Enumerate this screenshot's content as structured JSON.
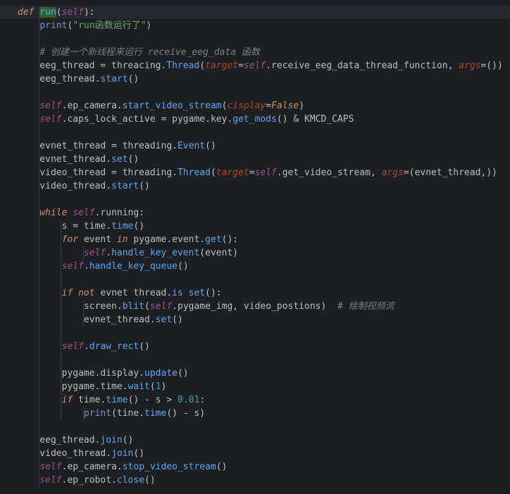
{
  "editor": {
    "language": "python",
    "theme_colors": {
      "background": "#1e1f22",
      "keyword": "#cf8e6d",
      "self": "#94558d",
      "function": "#56a8f5",
      "string": "#6aab73",
      "number": "#2aacb8",
      "comment": "#7a7e85",
      "text": "#bcbec4"
    },
    "lines": [
      [
        {
          "t": "def ",
          "c": "kw"
        },
        {
          "t": "run",
          "c": "fn hl"
        },
        {
          "t": "(",
          "c": "txt"
        },
        {
          "t": "self",
          "c": "self"
        },
        {
          "t": "):",
          "c": "txt"
        }
      ],
      [
        {
          "t": "    ",
          "c": "txt"
        },
        {
          "t": "print",
          "c": "builtin"
        },
        {
          "t": "(",
          "c": "txt"
        },
        {
          "t": "\"run函数运行了\"",
          "c": "str"
        },
        {
          "t": ")",
          "c": "txt"
        }
      ],
      [],
      [
        {
          "t": "    ",
          "c": "txt"
        },
        {
          "t": "# 创建一个新线程来运行 receive_eeg_data 函数",
          "c": "com"
        }
      ],
      [
        {
          "t": "    eeg_thread = threacing.",
          "c": "txt"
        },
        {
          "t": "Thread",
          "c": "fn"
        },
        {
          "t": "(",
          "c": "txt"
        },
        {
          "t": "target",
          "c": "param"
        },
        {
          "t": "=",
          "c": "txt"
        },
        {
          "t": "self",
          "c": "self"
        },
        {
          "t": ".receive_eeg_data_thread_function, ",
          "c": "txt"
        },
        {
          "t": "args",
          "c": "param"
        },
        {
          "t": "=())",
          "c": "txt"
        }
      ],
      [
        {
          "t": "    eeg_thread.",
          "c": "txt"
        },
        {
          "t": "start",
          "c": "fn"
        },
        {
          "t": "()",
          "c": "txt"
        }
      ],
      [],
      [
        {
          "t": "    ",
          "c": "txt"
        },
        {
          "t": "self",
          "c": "self"
        },
        {
          "t": ".ep_camera.",
          "c": "txt"
        },
        {
          "t": "start_video_stream",
          "c": "fn"
        },
        {
          "t": "(",
          "c": "txt"
        },
        {
          "t": "cisplay",
          "c": "param"
        },
        {
          "t": "=",
          "c": "txt"
        },
        {
          "t": "False",
          "c": "kw"
        },
        {
          "t": ")",
          "c": "txt"
        }
      ],
      [
        {
          "t": "    ",
          "c": "txt"
        },
        {
          "t": "self",
          "c": "self"
        },
        {
          "t": ".caps_lock_active = pygame.key.",
          "c": "txt"
        },
        {
          "t": "get_mods",
          "c": "fn"
        },
        {
          "t": "() & KMCD_CAPS",
          "c": "txt"
        }
      ],
      [],
      [
        {
          "t": "    evnet_thread = threading.",
          "c": "txt"
        },
        {
          "t": "Event",
          "c": "fn"
        },
        {
          "t": "()",
          "c": "txt"
        }
      ],
      [
        {
          "t": "    evnet_thread.",
          "c": "txt"
        },
        {
          "t": "set",
          "c": "fn"
        },
        {
          "t": "()",
          "c": "txt"
        }
      ],
      [
        {
          "t": "    video_thread = threading.",
          "c": "txt"
        },
        {
          "t": "Thread",
          "c": "fn"
        },
        {
          "t": "(",
          "c": "txt"
        },
        {
          "t": "target",
          "c": "param"
        },
        {
          "t": "=",
          "c": "txt"
        },
        {
          "t": "self",
          "c": "self"
        },
        {
          "t": ".get_video_stream, ",
          "c": "txt"
        },
        {
          "t": "args",
          "c": "param"
        },
        {
          "t": "=(evnet_thread,))",
          "c": "txt"
        }
      ],
      [
        {
          "t": "    video_thread.",
          "c": "txt"
        },
        {
          "t": "start",
          "c": "fn"
        },
        {
          "t": "()",
          "c": "txt"
        }
      ],
      [],
      [
        {
          "t": "    ",
          "c": "txt"
        },
        {
          "t": "while ",
          "c": "kw"
        },
        {
          "t": "self",
          "c": "self"
        },
        {
          "t": ".running:",
          "c": "txt"
        }
      ],
      [
        {
          "t": "        s = time.",
          "c": "txt"
        },
        {
          "t": "time",
          "c": "fn"
        },
        {
          "t": "()",
          "c": "txt"
        }
      ],
      [
        {
          "t": "        ",
          "c": "txt"
        },
        {
          "t": "for ",
          "c": "kw"
        },
        {
          "t": "event ",
          "c": "txt"
        },
        {
          "t": "in ",
          "c": "kw"
        },
        {
          "t": "pygame.event.",
          "c": "txt"
        },
        {
          "t": "get",
          "c": "fn"
        },
        {
          "t": "():",
          "c": "txt"
        }
      ],
      [
        {
          "t": "            ",
          "c": "txt"
        },
        {
          "t": "self",
          "c": "self"
        },
        {
          "t": ".",
          "c": "txt"
        },
        {
          "t": "handle_key_event",
          "c": "fn"
        },
        {
          "t": "(event)",
          "c": "txt"
        }
      ],
      [
        {
          "t": "        ",
          "c": "txt"
        },
        {
          "t": "self",
          "c": "self"
        },
        {
          "t": ".",
          "c": "txt"
        },
        {
          "t": "handle_key_queue",
          "c": "fn"
        },
        {
          "t": "()",
          "c": "txt"
        }
      ],
      [],
      [
        {
          "t": "        ",
          "c": "txt"
        },
        {
          "t": "if not ",
          "c": "kw"
        },
        {
          "t": "evnet thread.",
          "c": "txt"
        },
        {
          "t": "is set",
          "c": "fn"
        },
        {
          "t": "():",
          "c": "txt"
        }
      ],
      [
        {
          "t": "            screen.",
          "c": "txt"
        },
        {
          "t": "blit",
          "c": "fn"
        },
        {
          "t": "(",
          "c": "txt"
        },
        {
          "t": "self",
          "c": "self"
        },
        {
          "t": ".pygame_img, video_postions)  ",
          "c": "txt"
        },
        {
          "t": "# 绘制视频流",
          "c": "com"
        }
      ],
      [
        {
          "t": "            evnet_thread.",
          "c": "txt"
        },
        {
          "t": "set",
          "c": "fn"
        },
        {
          "t": "()",
          "c": "txt"
        }
      ],
      [],
      [
        {
          "t": "        ",
          "c": "txt"
        },
        {
          "t": "self",
          "c": "self"
        },
        {
          "t": ".",
          "c": "txt"
        },
        {
          "t": "draw_rect",
          "c": "fn"
        },
        {
          "t": "()",
          "c": "txt"
        }
      ],
      [],
      [
        {
          "t": "        pygame.display.",
          "c": "txt"
        },
        {
          "t": "update",
          "c": "fn"
        },
        {
          "t": "()",
          "c": "txt"
        }
      ],
      [
        {
          "t": "        pygame.time.",
          "c": "txt"
        },
        {
          "t": "wait",
          "c": "fn"
        },
        {
          "t": "(",
          "c": "txt"
        },
        {
          "t": "1",
          "c": "num"
        },
        {
          "t": ")",
          "c": "txt"
        }
      ],
      [
        {
          "t": "        ",
          "c": "txt"
        },
        {
          "t": "if ",
          "c": "kw"
        },
        {
          "t": "time.",
          "c": "txt"
        },
        {
          "t": "time",
          "c": "fn"
        },
        {
          "t": "() - s > ",
          "c": "txt"
        },
        {
          "t": "0.01",
          "c": "num"
        },
        {
          "t": ":",
          "c": "txt"
        }
      ],
      [
        {
          "t": "            ",
          "c": "txt"
        },
        {
          "t": "print",
          "c": "builtin"
        },
        {
          "t": "(tine.",
          "c": "txt"
        },
        {
          "t": "time",
          "c": "fn"
        },
        {
          "t": "() - s)",
          "c": "txt"
        }
      ],
      [],
      [
        {
          "t": "    eeg_thread.",
          "c": "txt"
        },
        {
          "t": "join",
          "c": "fn"
        },
        {
          "t": "()",
          "c": "txt"
        }
      ],
      [
        {
          "t": "    video_thread.",
          "c": "txt"
        },
        {
          "t": "join",
          "c": "fn"
        },
        {
          "t": "()",
          "c": "txt"
        }
      ],
      [
        {
          "t": "    ",
          "c": "txt"
        },
        {
          "t": "self",
          "c": "self"
        },
        {
          "t": ".ep_camera.",
          "c": "txt"
        },
        {
          "t": "stop_video_stream",
          "c": "fn"
        },
        {
          "t": "()",
          "c": "txt"
        }
      ],
      [
        {
          "t": "    ",
          "c": "txt"
        },
        {
          "t": "self",
          "c": "self"
        },
        {
          "t": ".ep_robot.",
          "c": "txt"
        },
        {
          "t": "close",
          "c": "fn"
        },
        {
          "t": "()",
          "c": "txt"
        }
      ]
    ]
  }
}
